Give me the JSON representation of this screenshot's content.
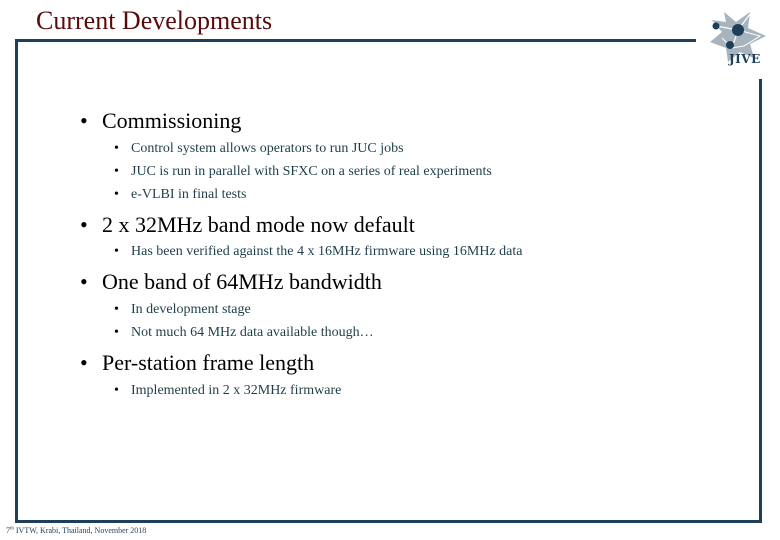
{
  "slide": {
    "title": "Current Developments",
    "logo_text": "JIVE",
    "footer": {
      "ordinal": "7",
      "ordinal_suffix": "th",
      "text": " IVTW, Krabi, Thailand, November 2018"
    },
    "colors": {
      "title": "#5a0a0a",
      "frame": "#1e3f5a",
      "subtext": "#1e3f4a"
    },
    "sections": [
      {
        "heading": "Commissioning",
        "items": [
          "Control system allows operators to run JUC jobs",
          "JUC is run in parallel with SFXC on a series of real experiments",
          "e-VLBI in final tests"
        ]
      },
      {
        "heading": "2 x 32MHz band mode now default",
        "items": [
          "Has been verified against the 4 x 16MHz firmware using 16MHz data"
        ]
      },
      {
        "heading": "One band of 64MHz bandwidth",
        "items": [
          "In development stage",
          "Not much 64 MHz data available though…"
        ]
      },
      {
        "heading": "Per-station frame length",
        "items": [
          "Implemented in 2 x 32MHz firmware"
        ]
      }
    ],
    "bullet_glyph": "•"
  }
}
